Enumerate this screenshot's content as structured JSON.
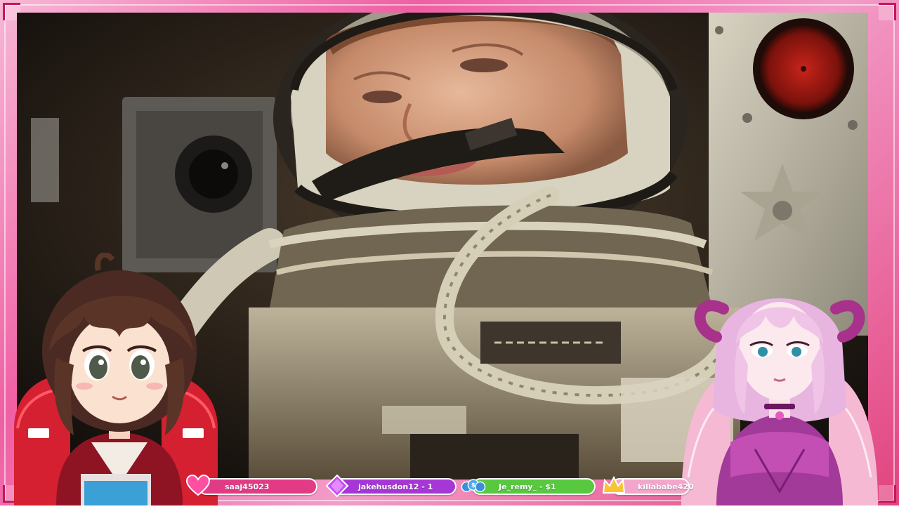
{
  "stream": {
    "frame_color": "#ef5fa4",
    "accent_color": "#c2185b"
  },
  "alerts": [
    {
      "text": "saaj45023",
      "icon": "heart-icon",
      "color": "#e23b86"
    },
    {
      "text": "jakehusdon12 - 1",
      "icon": "gem-icon",
      "color": "#a637d6"
    },
    {
      "text": "Je_remy_ - $1",
      "icon": "coins-icon",
      "color": "#57c83f"
    },
    {
      "text": "killababe420",
      "icon": "crown-icon",
      "color": "#f2a6cb"
    }
  ]
}
